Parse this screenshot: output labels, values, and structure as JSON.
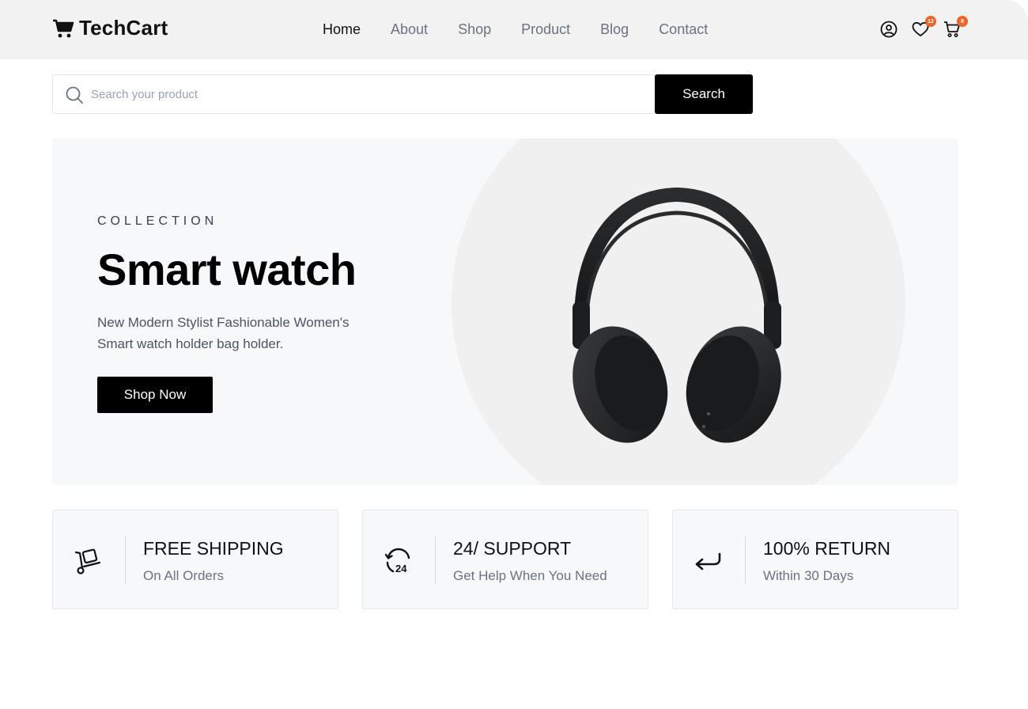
{
  "brand": {
    "name": "TechCart"
  },
  "nav": {
    "items": [
      {
        "label": "Home",
        "active": true
      },
      {
        "label": "About",
        "active": false
      },
      {
        "label": "Shop",
        "active": false
      },
      {
        "label": "Product",
        "active": false
      },
      {
        "label": "Blog",
        "active": false
      },
      {
        "label": "Contact",
        "active": false
      }
    ]
  },
  "header_icons": {
    "account_icon": "user-circle-icon",
    "wishlist_icon": "heart-icon",
    "wishlist_count": "12",
    "cart_icon": "cart-icon",
    "cart_count": "8"
  },
  "search": {
    "placeholder": "Search your product",
    "value": "",
    "button_label": "Search"
  },
  "hero": {
    "eyebrow": "COLLECTION",
    "title": "Smart watch",
    "description": "New Modern Stylist Fashionable Women's Smart watch holder bag holder.",
    "button_label": "Shop Now",
    "image": "headphones"
  },
  "features": [
    {
      "icon": "hand-truck-icon",
      "title": "FREE SHIPPING",
      "subtitle": "On All Orders"
    },
    {
      "icon": "support-24-icon",
      "title": "24/ SUPPORT",
      "subtitle": "Get Help When You Need"
    },
    {
      "icon": "return-arrow-icon",
      "title": "100% RETURN",
      "subtitle": "Within 30 Days"
    }
  ],
  "colors": {
    "accent": "#000000",
    "badge": "#f26522",
    "header_bg": "#f2f2f2",
    "hero_bg": "#f7f8fa"
  }
}
